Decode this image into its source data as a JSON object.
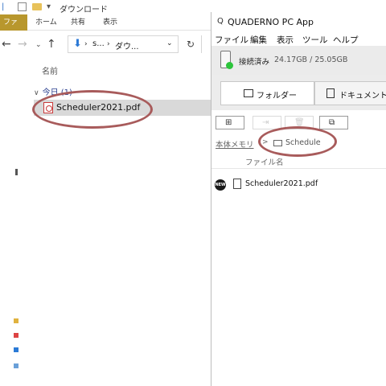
{
  "explorer": {
    "title": "ダウンロード",
    "ribbon_tabs": [
      "ファイル",
      "ホーム",
      "共有",
      "表示"
    ],
    "address": {
      "crumb_short": "s...",
      "crumb_current": "ダウ..."
    },
    "column_header": "名前",
    "group_label": "今日 (1)",
    "file_name": "Scheduler2021.pdf"
  },
  "quaderno": {
    "title": "QUADERNO PC App",
    "menu": [
      "ファイル",
      "編集",
      "表示",
      "ツール",
      "ヘルプ"
    ],
    "status": {
      "label": "接続済み",
      "storage": "24.17GB / 25.05GB",
      "status_color": "#2cc43b"
    },
    "tabs": [
      {
        "label": "フォルダー",
        "icon": "folder-icon"
      },
      {
        "label": "ドキュメント",
        "icon": "document-icon"
      }
    ],
    "toolbar_icons": [
      "new-folder-icon",
      "move-icon",
      "delete-icon",
      "upload-folder-icon"
    ],
    "breadcrumb": {
      "root": "本体メモリ",
      "separator": ">",
      "current": "Schedule"
    },
    "column_header": "ファイル名",
    "file_name": "Scheduler2021.pdf",
    "new_badge": "NEW"
  },
  "annotation_color": "#a85b5b"
}
